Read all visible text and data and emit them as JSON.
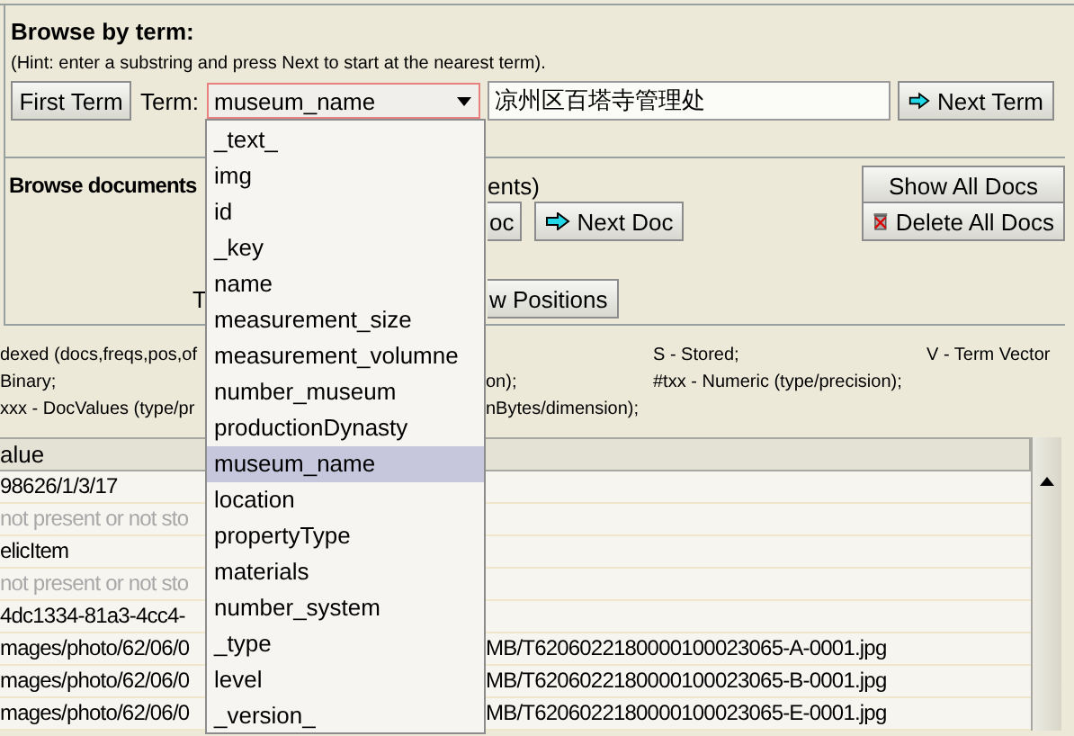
{
  "browse_by_term": {
    "title": "Browse by term:",
    "hint": "(Hint: enter a substring and press Next to start at the nearest term).",
    "first_term_button": "First Term",
    "term_label": "Term:",
    "term_value": "凉州区百塔寺管理处",
    "next_term_button": "Next Term",
    "field_select": {
      "value": "museum_name",
      "options": [
        {
          "label": "_text_",
          "selected": false
        },
        {
          "label": "img",
          "selected": false
        },
        {
          "label": "id",
          "selected": false
        },
        {
          "label": "_key",
          "selected": false
        },
        {
          "label": "name",
          "selected": false
        },
        {
          "label": "measurement_size",
          "selected": false
        },
        {
          "label": "measurement_volumne",
          "selected": false
        },
        {
          "label": "number_museum",
          "selected": false
        },
        {
          "label": "productionDynasty",
          "selected": false
        },
        {
          "label": "museum_name",
          "selected": true
        },
        {
          "label": "location",
          "selected": false
        },
        {
          "label": "propertyType",
          "selected": false
        },
        {
          "label": "materials",
          "selected": false
        },
        {
          "label": "number_system",
          "selected": false
        },
        {
          "label": "_type",
          "selected": false
        },
        {
          "label": "level",
          "selected": false
        },
        {
          "label": "_version_",
          "selected": false
        }
      ]
    }
  },
  "browse_documents": {
    "title": "Browse documents",
    "title_end": "ents)",
    "prev_doc_button": "oc",
    "next_doc_button": "Next Doc",
    "show_all_button": "Show All Docs",
    "delete_all_button": "Delete All Docs",
    "fragment": "T",
    "positions_button": "w Positions"
  },
  "legend": {
    "indexed": "dexed (docs,freqs,pos,of",
    "stored": "S - Stored;",
    "term_vector": "V - Term Vector",
    "binary": "Binary;",
    "precision_end": "on);",
    "numeric": "#txx - Numeric (type/precision);",
    "docvalues": "xxx - DocValues (type/pr",
    "dimension_end": "nBytes/dimension);"
  },
  "table": {
    "columns": [
      "alue"
    ],
    "rows": [
      {
        "column_1": "98626/1/3/17",
        "greyed": false
      },
      {
        "column_1": "not present or not sto",
        "greyed": true
      },
      {
        "column_1": "elicItem",
        "greyed": false
      },
      {
        "column_1": "not present or not sto",
        "greyed": true
      },
      {
        "column_1": "4dc1334-81a3-4cc4-",
        "greyed": false
      },
      {
        "column_1": "mages/photo/62/06/0",
        "column_1_end": "MB/T6206022180000100023065-A-0001.jpg",
        "greyed": false
      },
      {
        "column_1": "mages/photo/62/06/0",
        "column_1_end": "MB/T6206022180000100023065-B-0001.jpg",
        "greyed": false
      },
      {
        "column_1": "mages/photo/62/06/0",
        "column_1_end": "MB/T6206022180000100023065-E-0001.jpg",
        "greyed": false
      }
    ]
  }
}
